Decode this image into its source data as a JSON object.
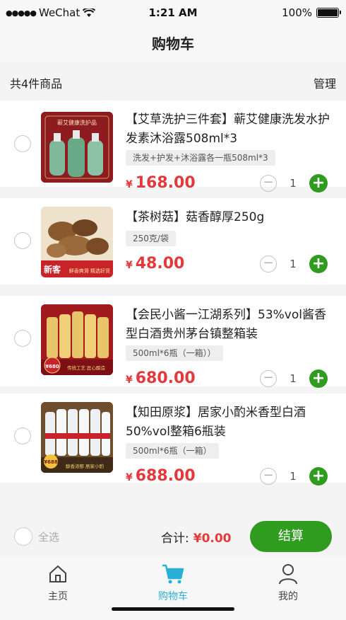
{
  "status": {
    "carrier": "WeChat",
    "time": "1:21 AM",
    "battery": "100%"
  },
  "nav": {
    "title": "购物车"
  },
  "summary": {
    "count_label": "共4件商品",
    "manage_label": "管理"
  },
  "items": [
    {
      "title": "【艾草洗护三件套】蕲艾健康洗发水护发素沐浴露508ml*3",
      "spec": "洗发+护发+沐浴露各一瓶508ml*3",
      "currency": "¥",
      "price": "168.00",
      "qty": "1",
      "image_text": "蕲艾健康洗护品"
    },
    {
      "title": "【茶树菇】菇香醇厚250g",
      "spec": "250克/袋",
      "currency": "¥",
      "price": "48.00",
      "qty": "1",
      "image_text": "新客",
      "image_sub": "鲜香爽滑 精选好货"
    },
    {
      "title": "【会民小酱一江湖系列】53%vol酱香型白酒贵州茅台镇整箱装",
      "spec": "500ml*6瓶（一箱））",
      "currency": "¥",
      "price": "680.00",
      "qty": "1",
      "image_text": "¥680",
      "image_sub": "传统工艺 匠心酿造"
    },
    {
      "title": "【知田原浆】居家小酌米香型白酒50%vol整箱6瓶装",
      "spec": "500ml*6瓶（一箱）",
      "currency": "¥",
      "price": "688.00",
      "qty": "1",
      "image_text": "¥688",
      "image_sub": "醇香浓郁 居家小酌"
    }
  ],
  "footer": {
    "select_all": "全选",
    "total_label": "合计:",
    "total_amount": "¥0.00",
    "checkout": "结算"
  },
  "tabs": [
    {
      "label": "主页",
      "icon": "home-icon"
    },
    {
      "label": "购物车",
      "icon": "cart-icon"
    },
    {
      "label": "我的",
      "icon": "user-icon"
    }
  ],
  "colors": {
    "accent_green": "#2f9b1f",
    "price_red": "#e4393c",
    "tab_active": "#2ab0d6"
  }
}
